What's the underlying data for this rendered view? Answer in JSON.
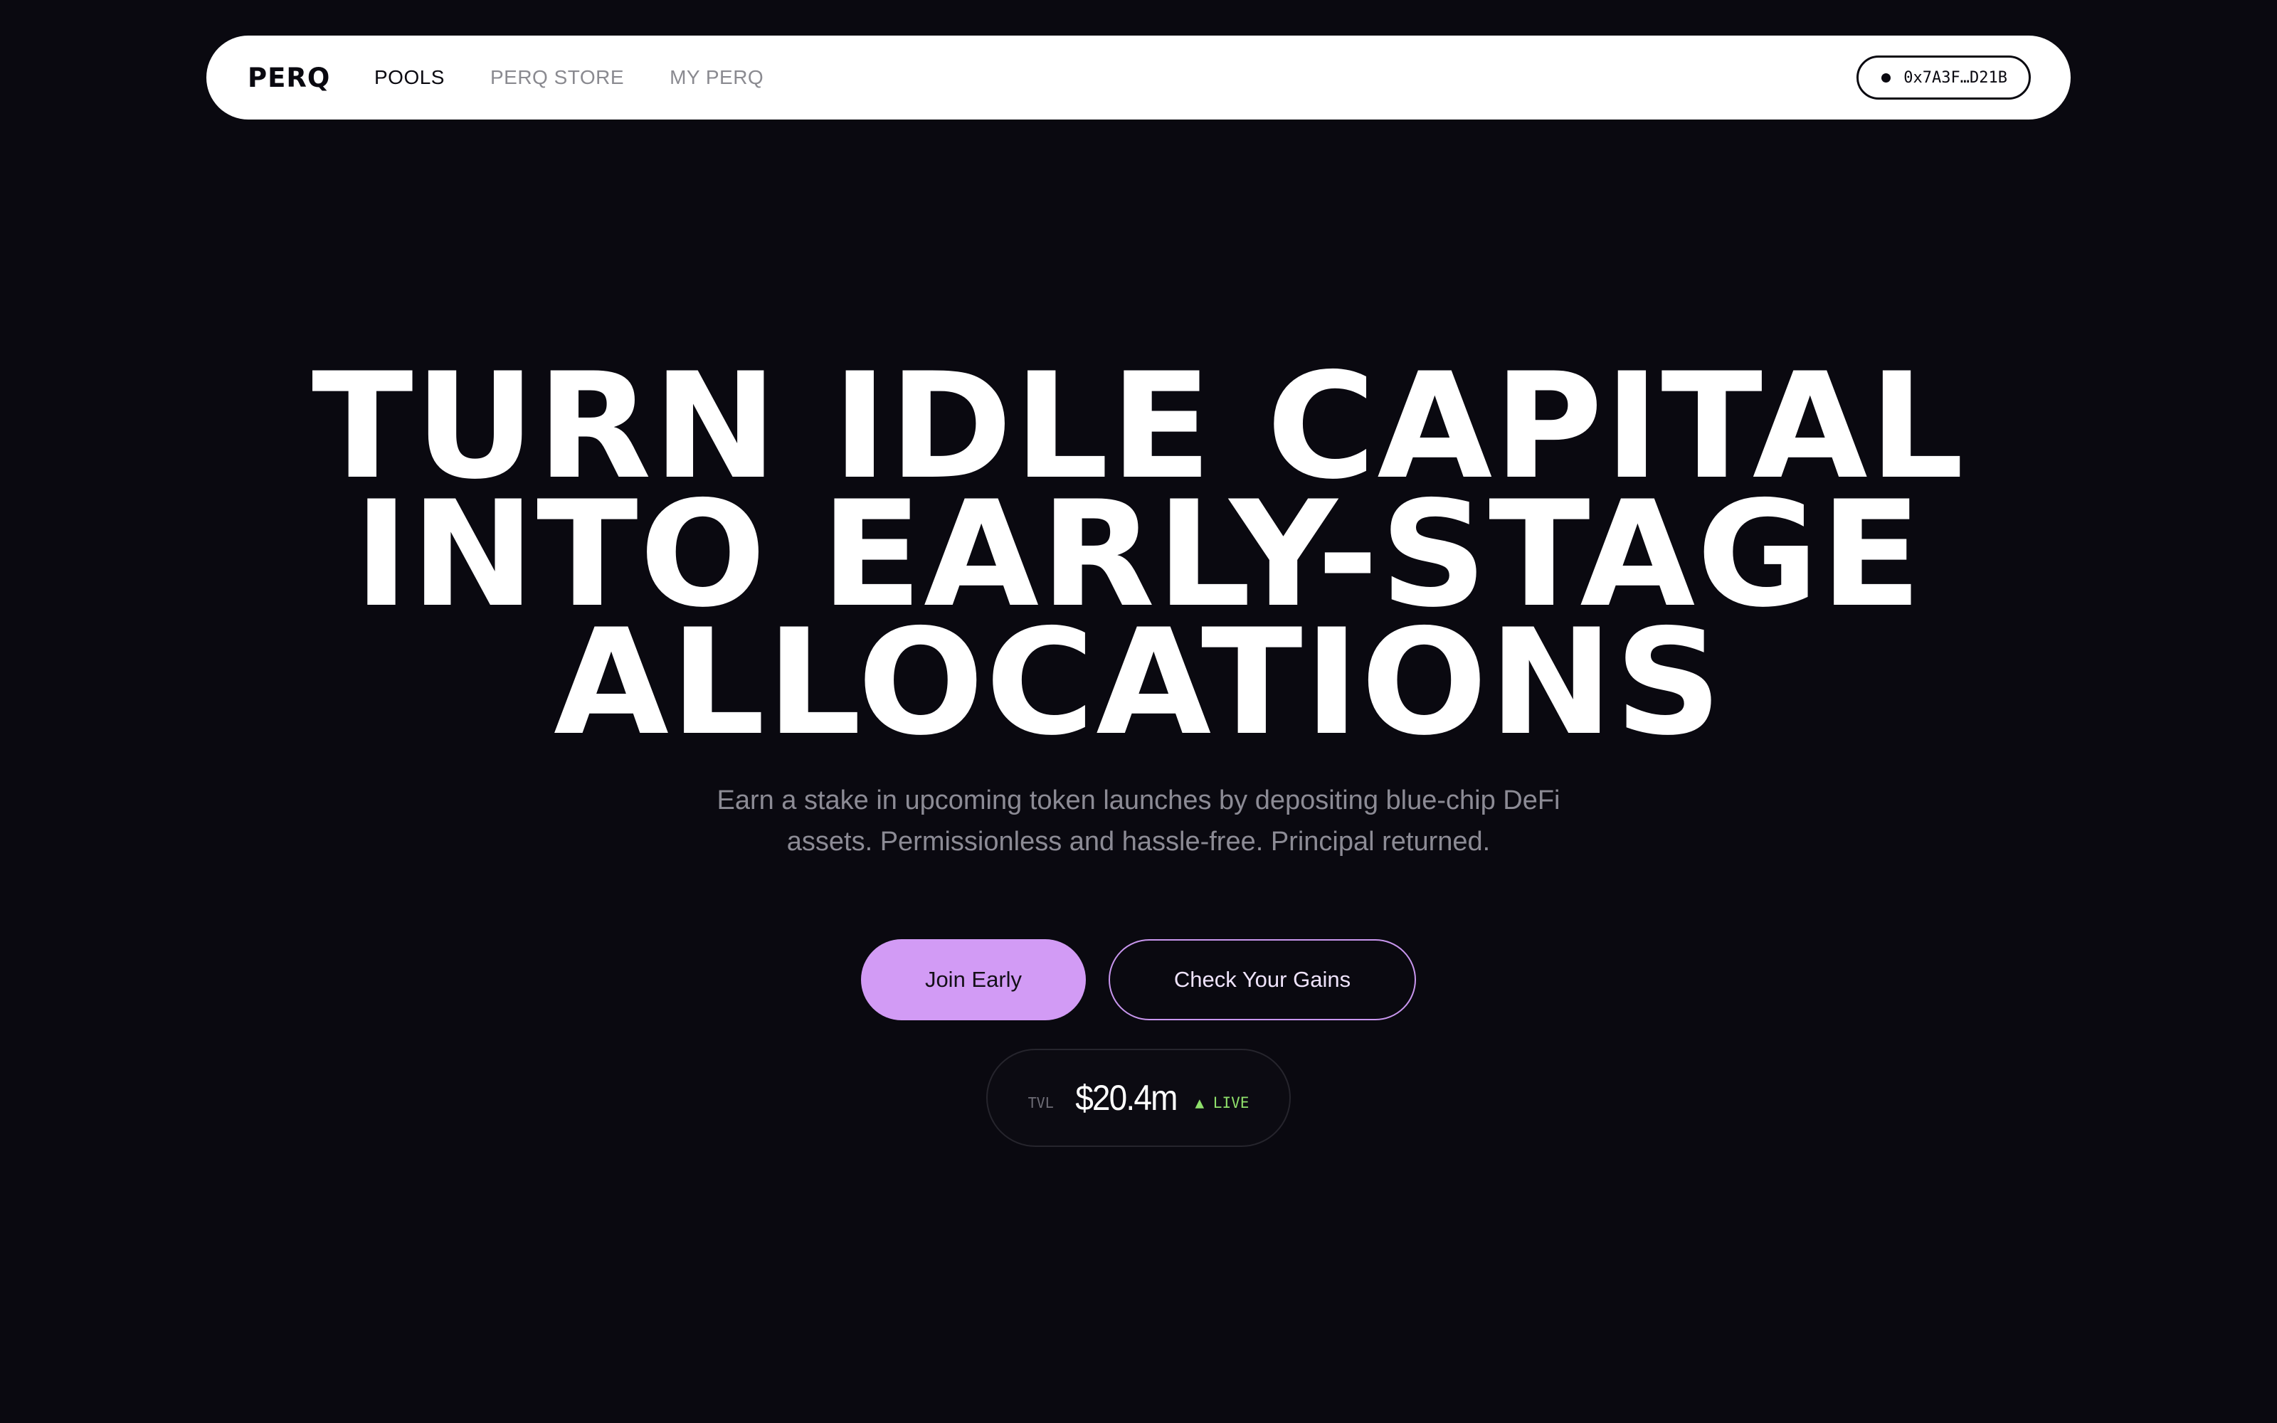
{
  "nav": {
    "logo": "PERQ",
    "links": [
      {
        "label": "POOLS",
        "active": true
      },
      {
        "label": "PERQ STORE",
        "active": false
      },
      {
        "label": "MY PERQ",
        "active": false
      }
    ],
    "wallet_address": "0x7A3F…D21B"
  },
  "hero": {
    "title_lines": [
      "TURN IDLE CAPITAL",
      "INTO EARLY-STAGE",
      "ALLOCATIONS"
    ],
    "subtitle_lines": [
      "Earn a stake in upcoming token launches by depositing blue-chip DeFi",
      "assets. Permissionless and hassle-free. Principal returned."
    ]
  },
  "cta": {
    "primary_label": "Join Early",
    "secondary_label": "Check Your Gains"
  },
  "tvl": {
    "label": "TVL",
    "value": "$20.4m",
    "status": "▲ LIVE"
  },
  "colors": {
    "background": "#0a0910",
    "accent": "#d29bf5",
    "live": "#8fe06b"
  }
}
